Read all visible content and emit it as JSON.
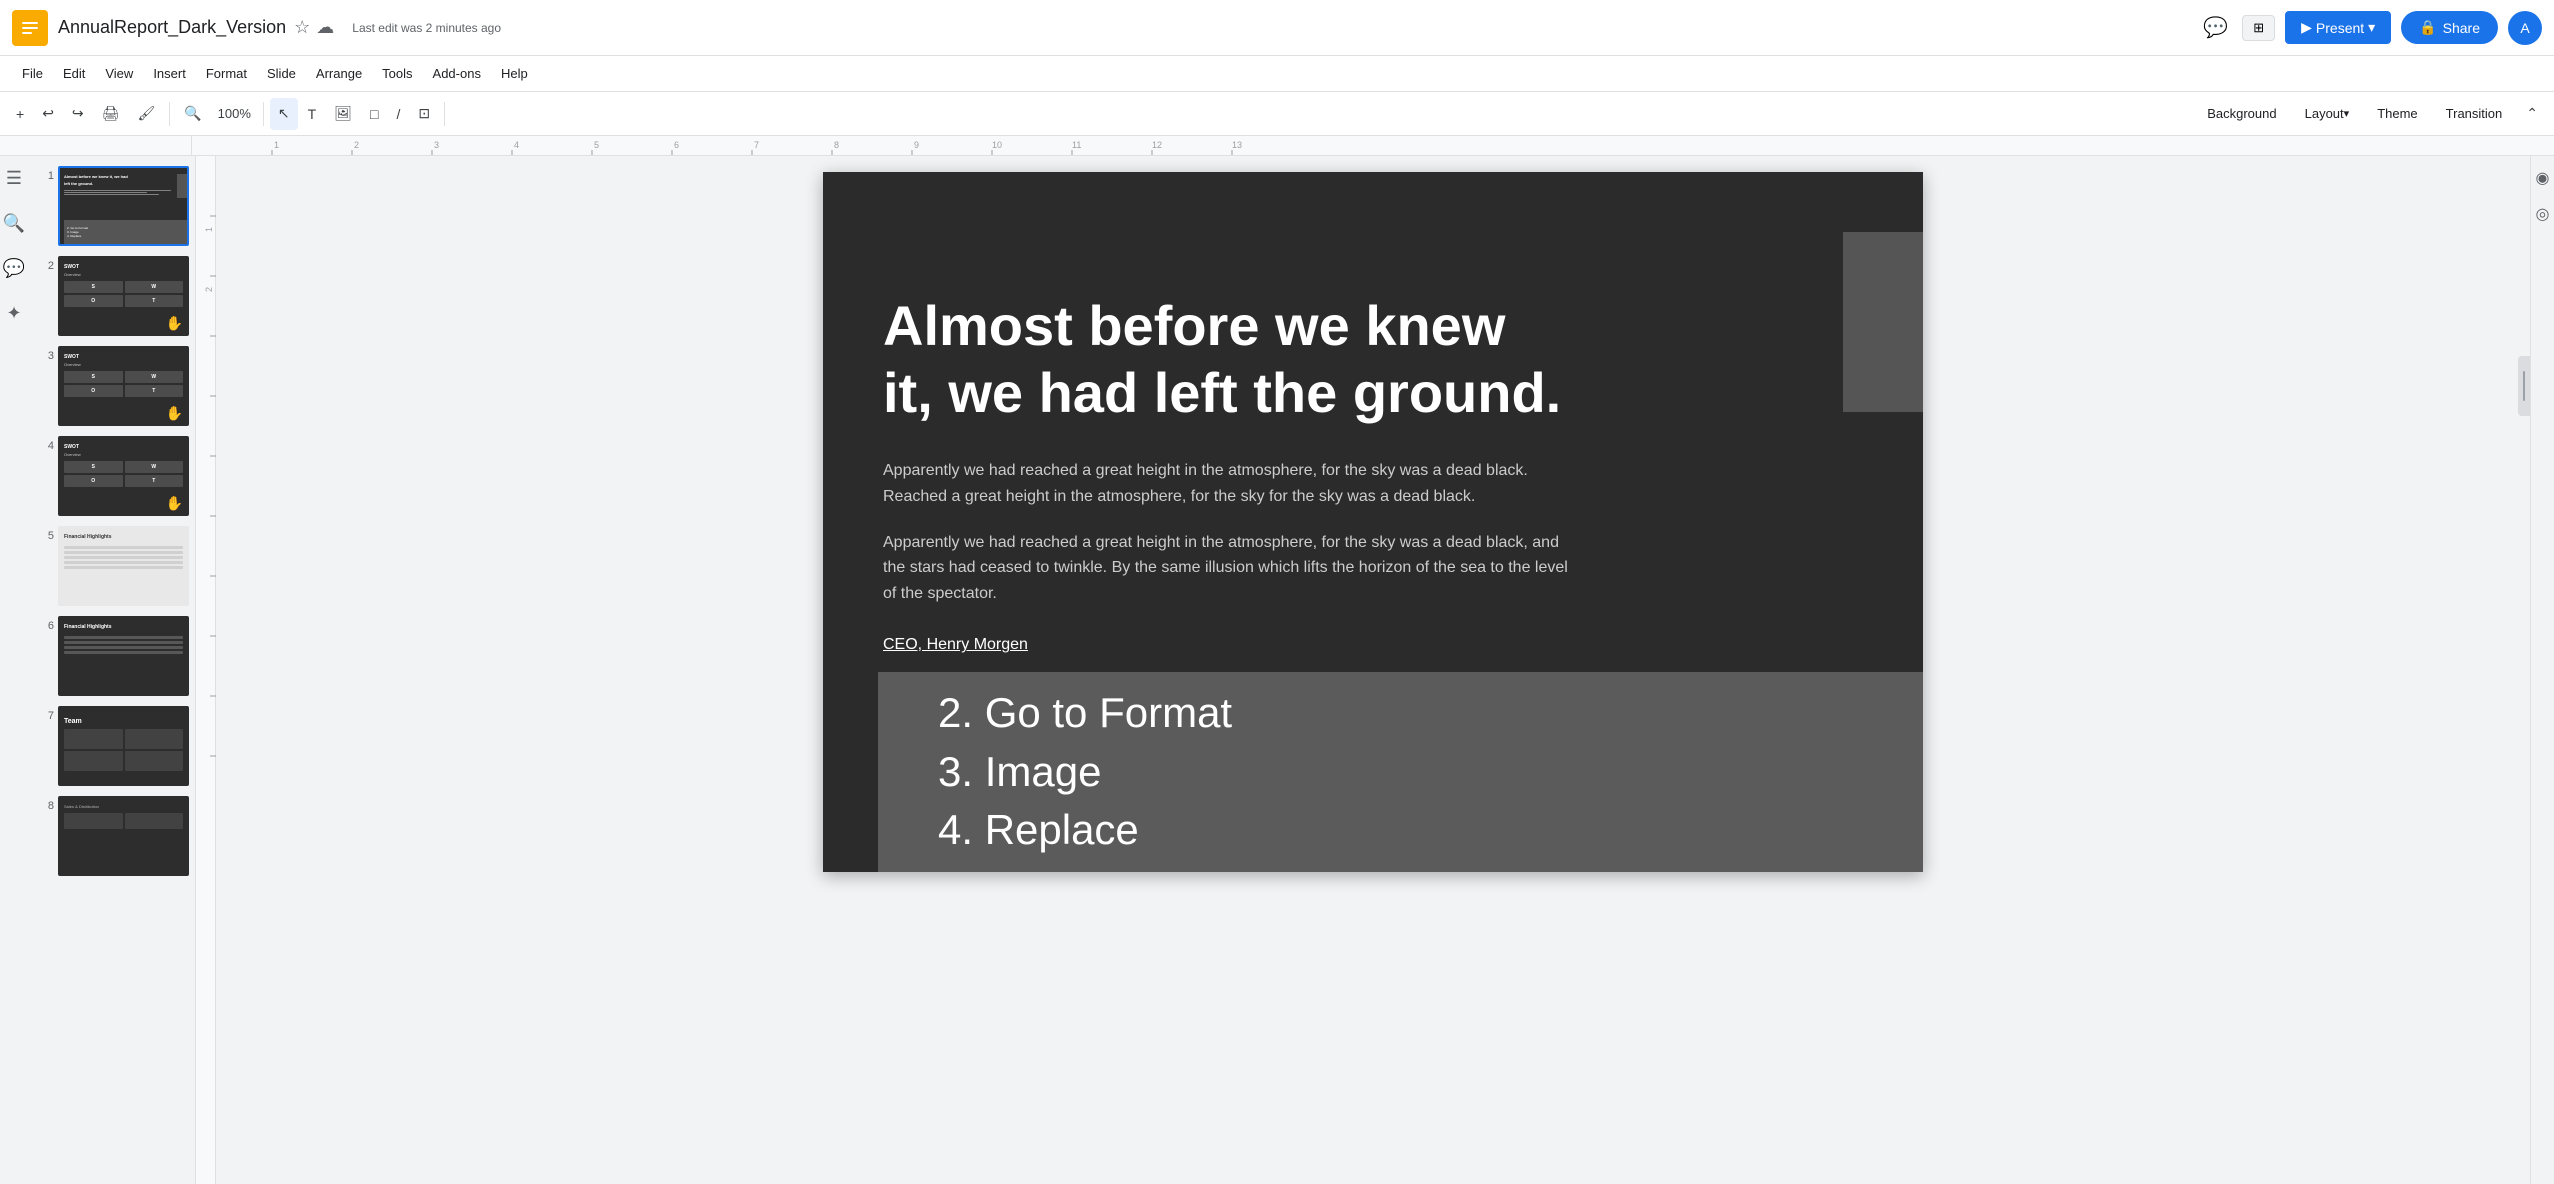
{
  "app": {
    "icon_color": "#F9AB00",
    "title": "AnnualReport_Dark_Version",
    "last_edit": "Last edit was 2 minutes ago"
  },
  "menu": {
    "items": [
      "File",
      "Edit",
      "View",
      "Insert",
      "Format",
      "Slide",
      "Arrange",
      "Tools",
      "Add-ons",
      "Help"
    ]
  },
  "toolbar": {
    "background_label": "Background",
    "layout_label": "Layout",
    "theme_label": "Theme",
    "transition_label": "Transition"
  },
  "slides": [
    {
      "number": "1",
      "active": true,
      "type": "title_dark"
    },
    {
      "number": "2",
      "active": false,
      "type": "swot"
    },
    {
      "number": "3",
      "active": false,
      "type": "swot"
    },
    {
      "number": "4",
      "active": false,
      "type": "swot"
    },
    {
      "number": "5",
      "active": false,
      "type": "financial_light"
    },
    {
      "number": "6",
      "active": false,
      "type": "financial_dark"
    },
    {
      "number": "7",
      "active": false,
      "type": "team"
    },
    {
      "number": "8",
      "active": false,
      "type": "dark_grid"
    }
  ],
  "slide": {
    "headline": "Almost before we knew it, we had left the ground.",
    "body1": "Apparently we had reached a great height in the atmosphere, for the sky was a dead black. Reached a great height in the atmosphere, for the sky for the sky was a dead black.",
    "body2": "Apparently we had reached a great height in the atmosphere, for the sky was a dead black, and the stars had ceased to twinkle. By the same illusion which lifts the horizon of the sea to the level of the spectator.",
    "ceo": "CEO, Henry Morgen",
    "overlay_line1": "2. Go to Format",
    "overlay_line2": "3. Image",
    "overlay_line3": "4. Replace"
  },
  "buttons": {
    "present": "Present",
    "share": "Share",
    "share_icon": "🔒"
  },
  "user": {
    "avatar_letter": "A"
  }
}
